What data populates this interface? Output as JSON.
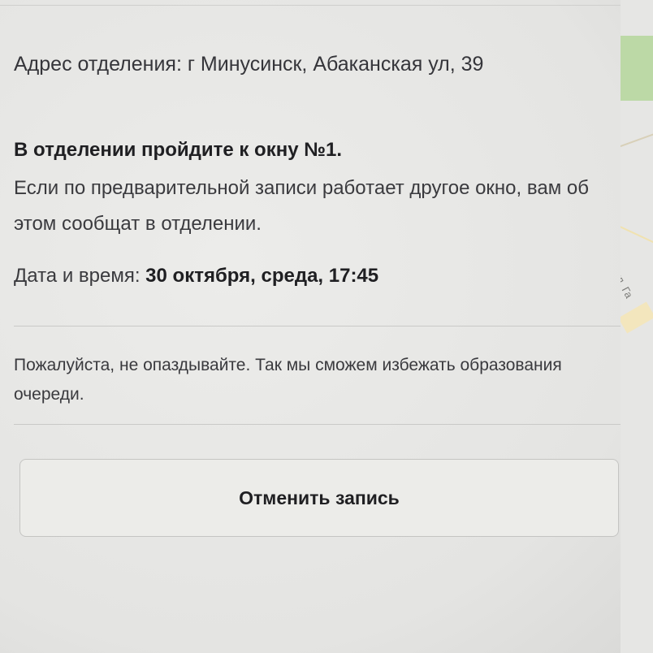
{
  "appointment": {
    "address": "Адрес отделения: г Минусинск, Абаканская ул, 39",
    "window_hint": "В отделении пройдите к окну №1.",
    "note": "Если по предварительной записи работает другое окно, вам об этом сообщат в отделении.",
    "datetime_label": "Дата и время:",
    "datetime_value": "30 октября, среда, 17:45"
  },
  "reminder": "Пожалуйста, не опаздывайте. Так мы сможем избежать образования очереди.",
  "cancel_button": "Отменить запись",
  "map": {
    "street_label": "ул. Га"
  },
  "colors": {
    "background": "#e9e9e7",
    "map_green": "#bcd9a6",
    "text": "#2c2c2e"
  }
}
